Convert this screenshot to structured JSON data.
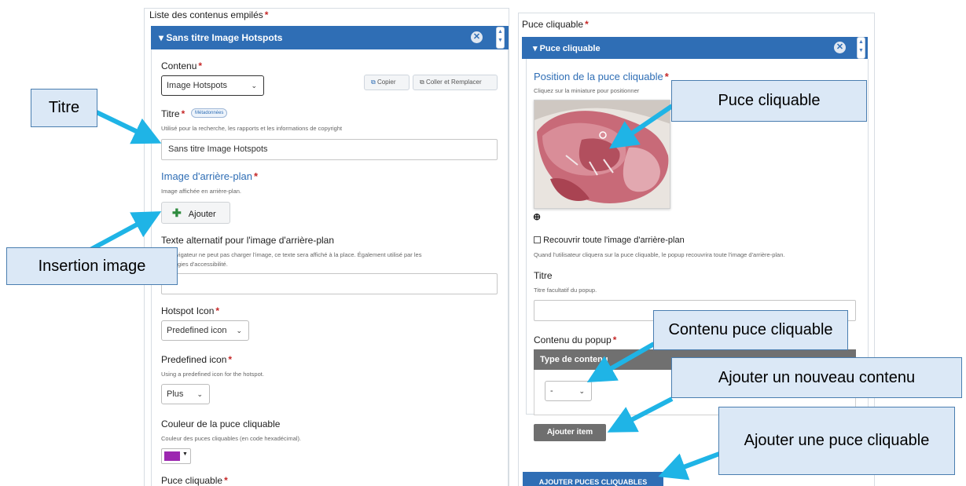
{
  "left": {
    "list_label": "Liste des contenus empilés",
    "header_title": "Sans titre Image Hotspots",
    "content_label": "Contenu",
    "content_value": "Image Hotspots",
    "copy_label": "Copier",
    "paste_label": "Coller et Remplacer",
    "title_label": "Titre",
    "metadata_badge": "Métadonnées",
    "title_desc": "Utilisé pour la recherche, les rapports et les informations de copyright",
    "title_value": "Sans titre Image Hotspots",
    "bg_title": "Image d'arrière-plan",
    "bg_desc": "Image affichée en arrière-plan.",
    "add_label": "Ajouter",
    "alt_label": "Texte alternatif pour l'image d'arrière-plan",
    "alt_desc_1": "avigateur ne peut pas charger l'image, ce texte sera affiché à la place. Également utilisé par les",
    "alt_desc_2": "logies d'accessibilité.",
    "hotspot_icon_label": "Hotspot Icon",
    "hotspot_icon_value": "Predefined icon",
    "predef_label": "Predefined icon",
    "predef_desc": "Using a predefined icon for the hotspot.",
    "predef_value": "Plus",
    "color_label": "Couleur de la puce cliquable",
    "color_desc": "Couleur des puces cliquables (en code hexadécimal).",
    "color_value": "#9c27b0",
    "bottom_label": "Puce cliquable"
  },
  "right": {
    "outer_label": "Puce cliquable",
    "header_title": "Puce cliquable",
    "position_title": "Position de la puce cliquable",
    "position_desc": "Cliquez sur la miniature pour positionner",
    "cover_label": "Recouvrir toute l'image d'arrière-plan",
    "cover_desc": "Quand l'utilisateur cliquera sur la puce cliquable, le popup recouvrira toute l'image d'arrière-plan.",
    "popup_title_label": "Titre",
    "popup_title_desc": "Titre facultatif du popup.",
    "popup_content_label": "Contenu du popup",
    "content_type_header": "Type de contenu",
    "content_type_value": "-",
    "add_item_label": "Ajouter item",
    "add_hotspots_label": "AJOUTER PUCES CLIQUABLES"
  },
  "callouts": {
    "titre": "Titre",
    "insertion_image": "Insertion image",
    "puce_cliquable": "Puce cliquable",
    "contenu_puce": "Contenu puce cliquable",
    "ajouter_contenu": "Ajouter un nouveau contenu",
    "ajouter_puce": "Ajouter une puce cliquable"
  },
  "colors": {
    "accent": "#2f6eb5",
    "callout_fill": "#dbe8f6",
    "arrow": "#1fb4e6",
    "required": "#c62828",
    "grey_button": "#6f6f6f"
  }
}
